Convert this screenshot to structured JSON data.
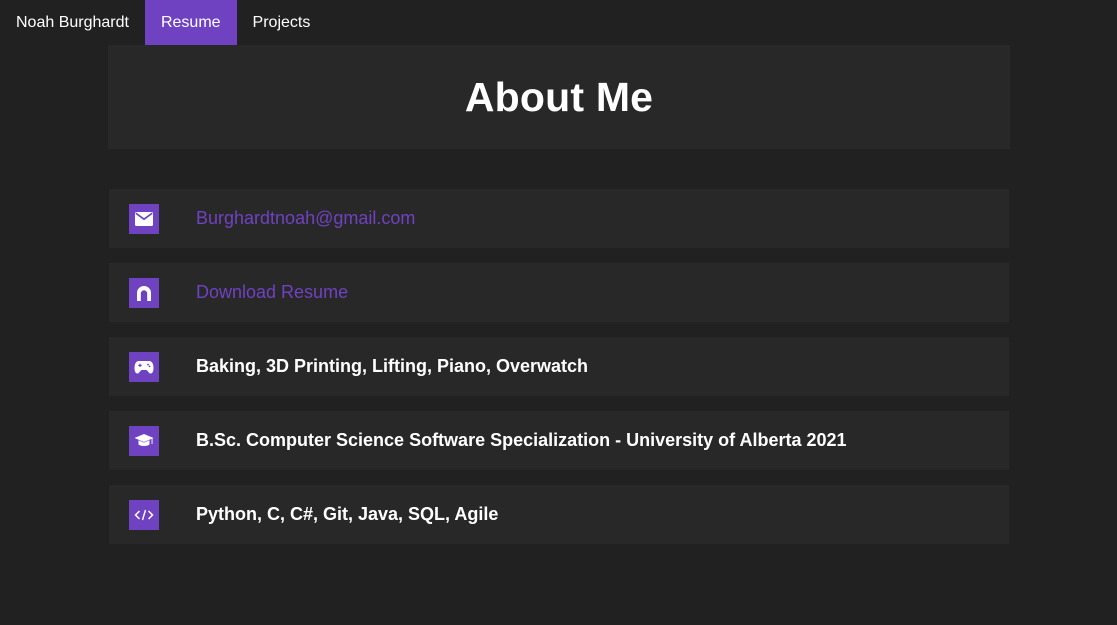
{
  "nav": {
    "items": [
      {
        "label": "Noah Burghardt",
        "active": false
      },
      {
        "label": "Resume",
        "active": true
      },
      {
        "label": "Projects",
        "active": false
      }
    ]
  },
  "header": {
    "title": "About Me"
  },
  "info": {
    "email": {
      "icon": "envelope-icon",
      "text": "Burghardtnoah@gmail.com"
    },
    "resume": {
      "icon": "resume-icon",
      "text": "Download Resume"
    },
    "hobbies": {
      "icon": "gamepad-icon",
      "text": "Baking, 3D Printing, Lifting, Piano, Overwatch"
    },
    "education": {
      "icon": "graduation-cap-icon",
      "text": "B.Sc. Computer Science Software Specialization - University of Alberta 2021"
    },
    "skills": {
      "icon": "code-icon",
      "text": "Python, C, C#, Git, Java, SQL, Agile"
    }
  },
  "colors": {
    "accent": "#6f42c1",
    "background": "#212121",
    "card": "#282828",
    "text": "#ffffff"
  }
}
